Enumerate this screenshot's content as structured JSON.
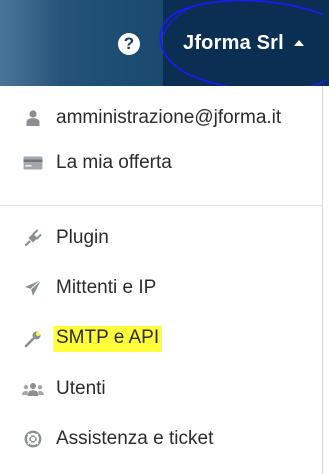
{
  "header": {
    "help_icon": "question-circle-icon",
    "account_name": "Jforma Srl",
    "account_caret_icon": "caret-up-icon",
    "help_glyph": "?"
  },
  "menu": {
    "items": [
      {
        "label": "amministrazione@jforma.it",
        "icon": "user-icon"
      },
      {
        "label": "La mia offerta",
        "icon": "credit-card-icon"
      },
      {
        "label": "Plugin",
        "icon": "plug-icon"
      },
      {
        "label": "Mittenti e IP",
        "icon": "paper-plane-icon"
      },
      {
        "label": "SMTP e API",
        "icon": "wrench-icon",
        "highlighted": true
      },
      {
        "label": "Utenti",
        "icon": "users-icon"
      },
      {
        "label": "Assistenza e ticket",
        "icon": "life-ring-icon"
      }
    ]
  },
  "colors": {
    "header_bg": "#1e4d74",
    "account_bg": "#0b2f52",
    "highlight": "#ffff3a",
    "annotation_circle": "#1a1aff"
  }
}
